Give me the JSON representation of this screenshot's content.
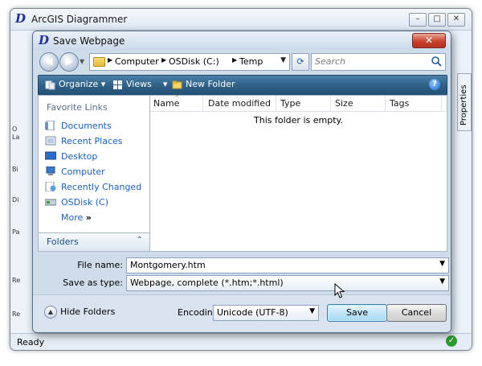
{
  "app": {
    "title": "ArcGIS Diagrammer",
    "logo": "D",
    "status": "Ready",
    "properties_tab": "Properties",
    "minimize_glyph": "–",
    "maximize_glyph": "□",
    "close_glyph": "✕",
    "side_letters": [
      "O",
      "La",
      "Bi",
      "Di",
      "Pa",
      "Re",
      "Re"
    ]
  },
  "dialog": {
    "title": "Save Webpage",
    "logo": "D",
    "close_glyph": "✕",
    "address": {
      "crumbs": [
        "Computer",
        "OSDisk (C:)",
        "Temp"
      ]
    },
    "search": {
      "placeholder": "Search"
    },
    "toolbar": {
      "organize": "Organize",
      "views": "Views",
      "new_folder": "New Folder",
      "help": "?"
    },
    "favorite_links": {
      "header": "Favorite Links",
      "items": [
        {
          "label": "Documents",
          "icon": "documents-icon"
        },
        {
          "label": "Recent Places",
          "icon": "recent-places-icon"
        },
        {
          "label": "Desktop",
          "icon": "desktop-icon"
        },
        {
          "label": "Computer",
          "icon": "computer-icon"
        },
        {
          "label": "Recently Changed",
          "icon": "recently-changed-icon"
        },
        {
          "label": "OSDisk (C)",
          "icon": "disk-icon"
        },
        {
          "label": "More",
          "icon": "more-icon"
        }
      ],
      "more_glyph": "»"
    },
    "folders": {
      "label": "Folders"
    },
    "columns": [
      "Name",
      "Date modified",
      "Type",
      "Size",
      "Tags"
    ],
    "empty_message": "This folder is empty.",
    "file_name": {
      "label": "File name:",
      "value": "Montgomery.htm"
    },
    "save_as_type": {
      "label": "Save as type:",
      "value": "Webpage, complete (*.htm;*.html)"
    },
    "hide_folders": "Hide Folders",
    "encoding": {
      "label": "Encoding:",
      "value": "Unicode (UTF-8)"
    },
    "buttons": {
      "save": "Save",
      "cancel": "Cancel"
    }
  }
}
